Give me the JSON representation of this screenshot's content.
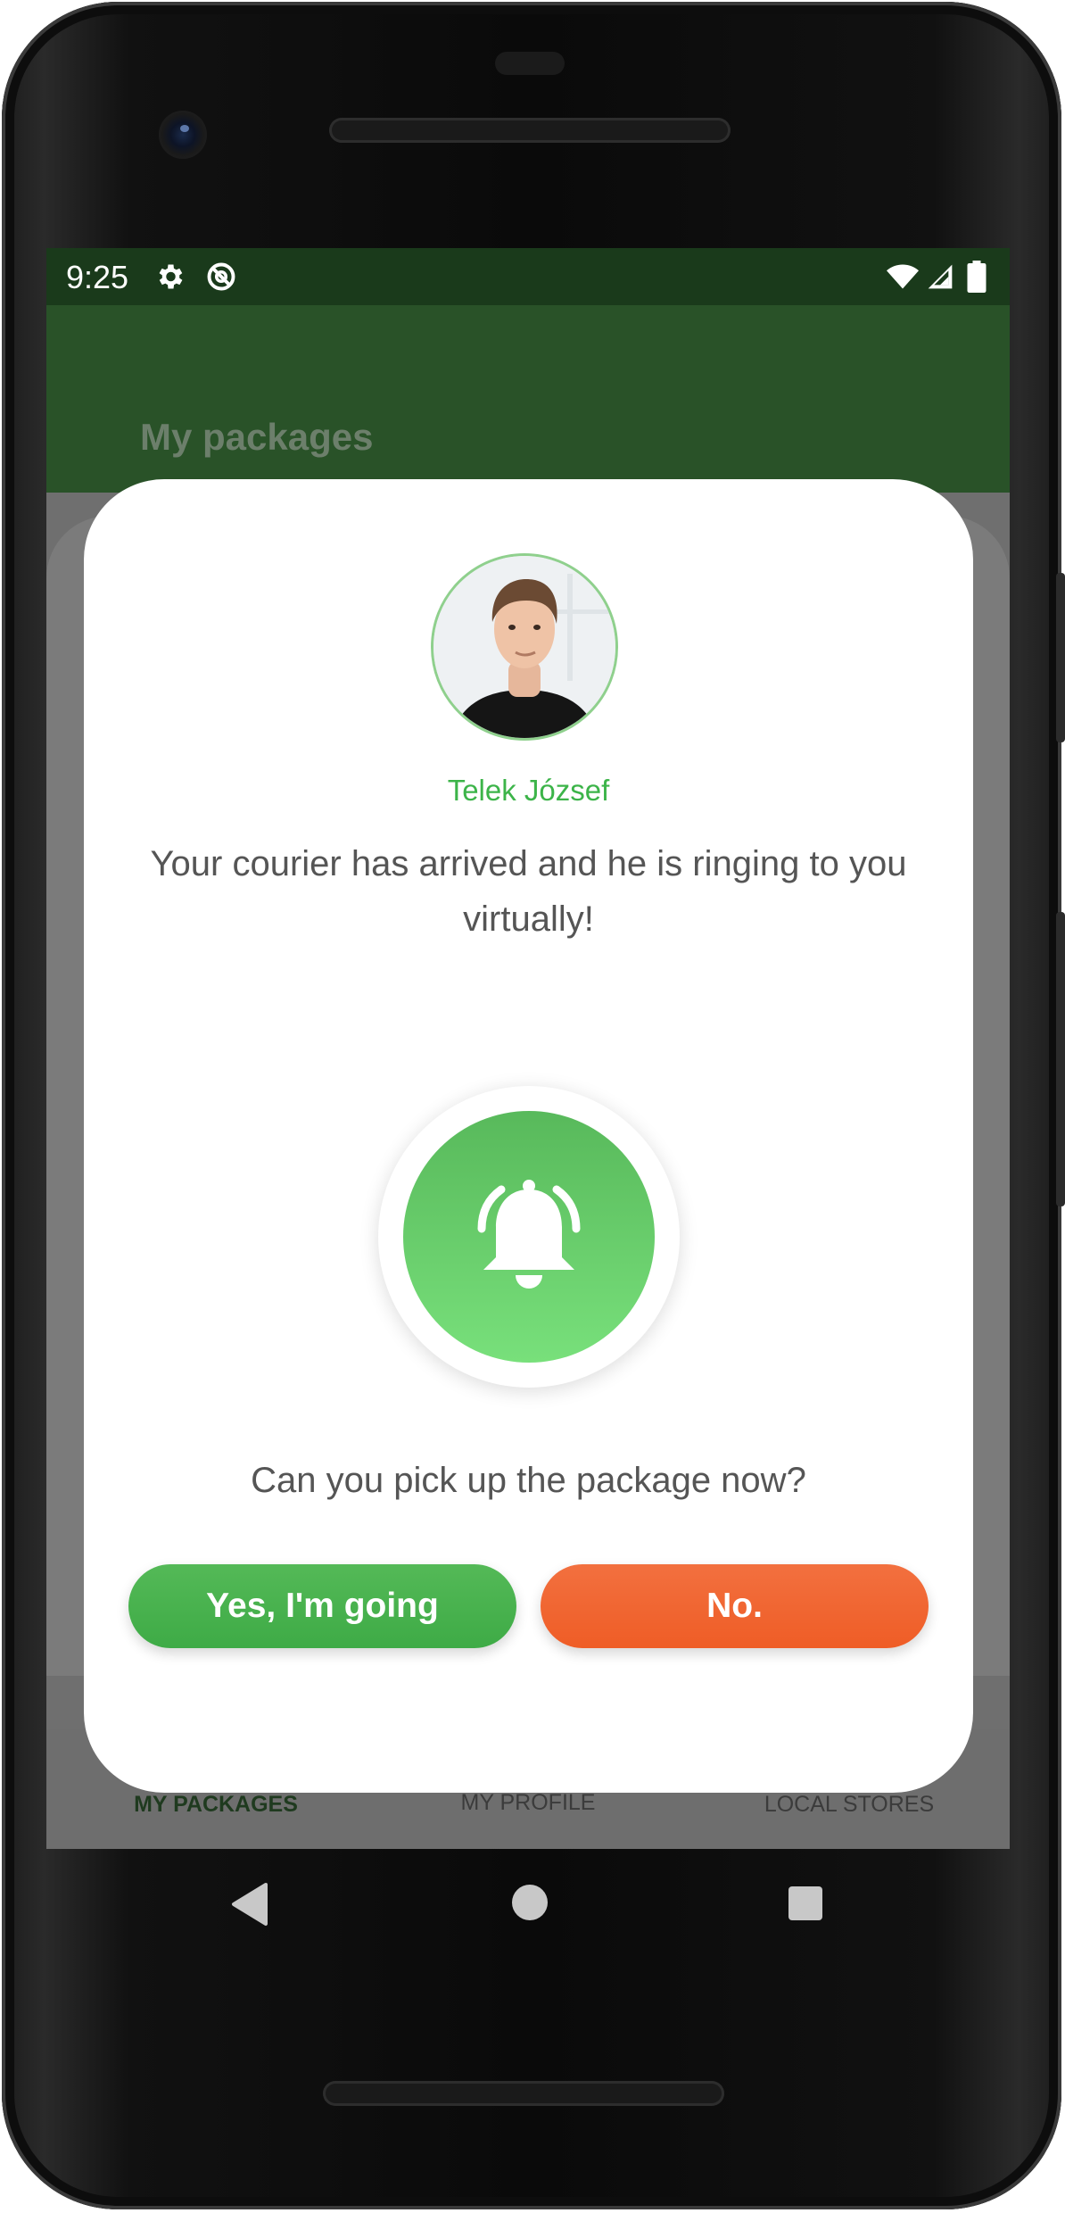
{
  "status_bar": {
    "time": "9:25",
    "icons": [
      "gear-icon",
      "sync-disabled-icon",
      "wifi-icon",
      "signal-icon",
      "battery-icon"
    ]
  },
  "app_bar": {
    "title": "My packages"
  },
  "dialog": {
    "courier_name": "Telek József",
    "message": "Your courier has arrived and he is ringing to you virtually!",
    "icon": "bell-ringing-icon",
    "question": "Can you pick up the package now?",
    "yes_label": "Yes, I'm going",
    "no_label": "No."
  },
  "bottom_nav": {
    "items": [
      {
        "label": "MY PACKAGES"
      },
      {
        "label": "MY PROFILE"
      },
      {
        "label": "LOCAL STORES"
      }
    ]
  },
  "colors": {
    "primary_dark": "#1a3a1b",
    "primary": "#295228",
    "accent_green": "#3cb449",
    "danger_orange": "#ef5d26"
  }
}
